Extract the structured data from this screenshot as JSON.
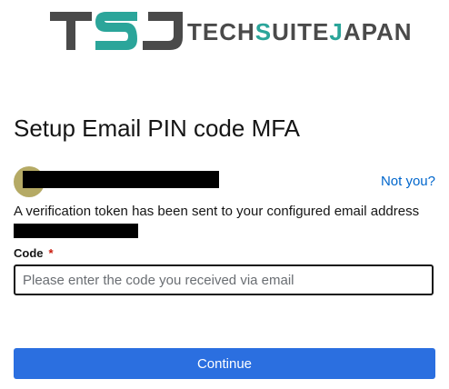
{
  "brand": {
    "logo_text": "TSJ",
    "wordmark": {
      "part1": "TECH",
      "accent": "S",
      "part2": "UITE",
      "accent2": "J",
      "part3": "APAN"
    },
    "colors": {
      "dark": "#4a4a4a",
      "accent": "#2ba59a"
    }
  },
  "page": {
    "title": "Setup Email PIN code MFA"
  },
  "user": {
    "not_you_label": "Not you?"
  },
  "info": {
    "message": "A verification token has been sent to your configured email address"
  },
  "form": {
    "code_label": "Code",
    "required_marker": "*",
    "code_placeholder": "Please enter the code you received via email",
    "submit_label": "Continue"
  },
  "colors": {
    "primary": "#2b6fe0",
    "link": "#0066cc",
    "required": "#c9190b"
  }
}
